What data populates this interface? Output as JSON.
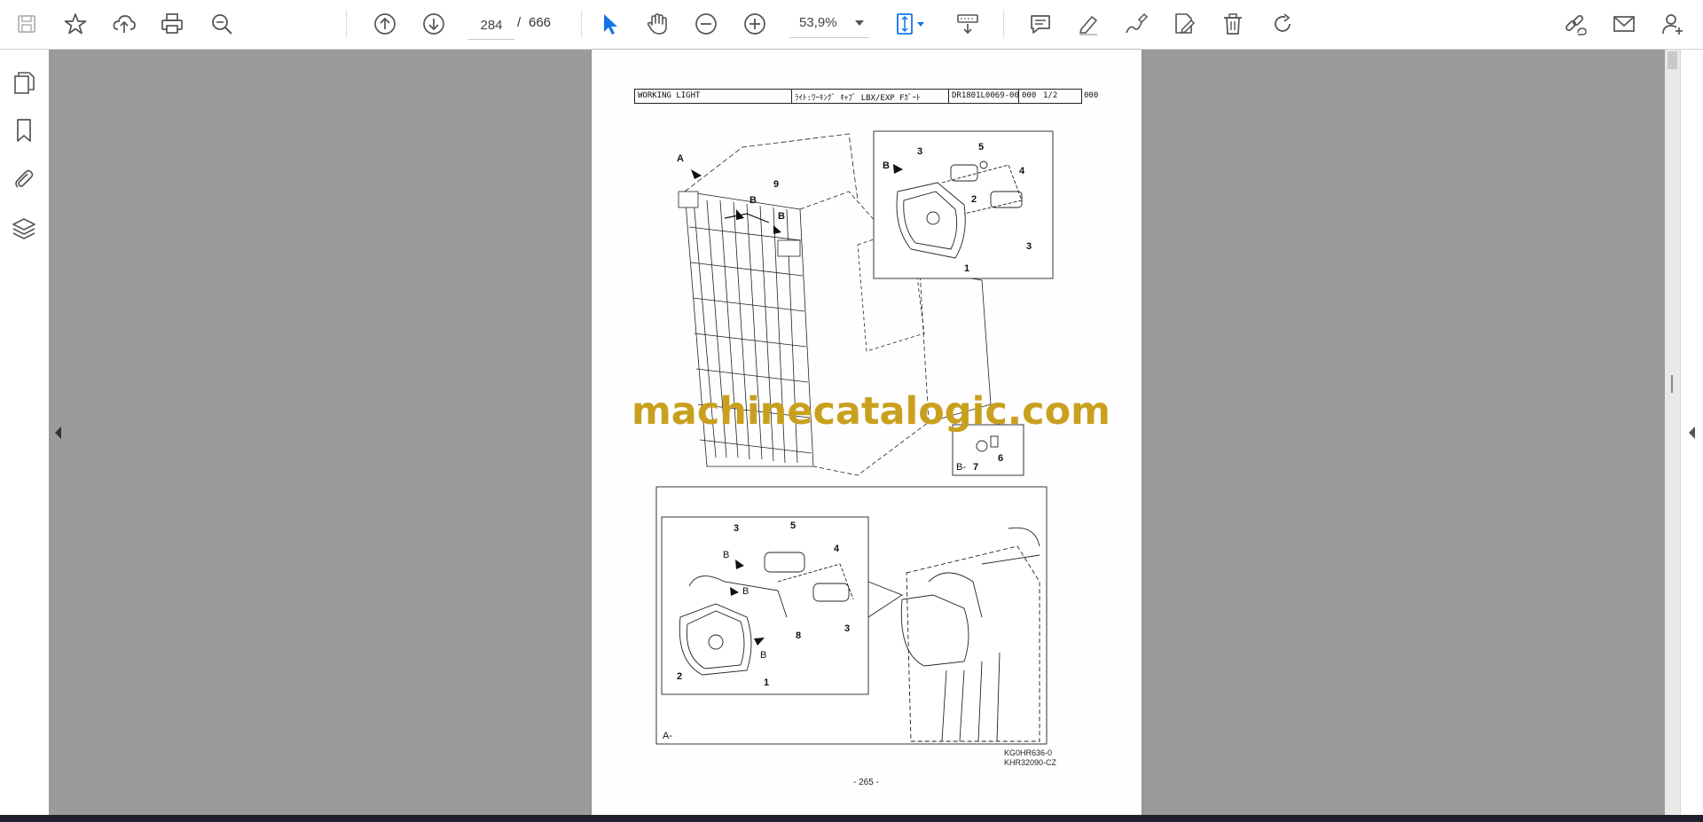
{
  "toolbar": {
    "page_current": "284",
    "page_separator": "/",
    "page_total": "666",
    "zoom": "53,9%",
    "icons": [
      "save-icon",
      "star-icon",
      "upload-icon",
      "print-icon",
      "zoom-search-icon",
      "page-up-icon",
      "page-down-icon",
      "select-cursor-icon",
      "hand-icon",
      "zoom-out-icon",
      "zoom-in-icon",
      "fit-page-icon",
      "scroll-mode-icon",
      "comment-icon",
      "highlight-icon",
      "draw-icon",
      "fill-sign-icon",
      "delete-icon",
      "rotate-icon",
      "share-link-icon",
      "email-icon",
      "add-user-icon"
    ]
  },
  "left_rail": {
    "icons": [
      "pages-icon",
      "bookmark-icon",
      "attachment-icon",
      "layers-icon"
    ]
  },
  "document": {
    "header": {
      "title": "WORKING LIGHT",
      "jp_title": "ﾗｲﾄ:ﾜｰｷﾝｸﾞ ｷｬﾌﾞ LBX/EXP Fｶﾞｰﾄ",
      "code": "DR1801L0069-00",
      "rev": "000",
      "sheet": "1/2",
      "extra": "000"
    },
    "watermark": "machinecatalogic.com",
    "callouts_main": [
      "A",
      "B",
      "B",
      "9"
    ],
    "callouts_detail_top": [
      "B",
      "3",
      "5",
      "4",
      "2",
      "3",
      "1"
    ],
    "callouts_detail_b": [
      "B-",
      "7",
      "6"
    ],
    "callouts_detail_a": [
      "3",
      "5",
      "4",
      "B",
      "B",
      "8",
      "3",
      "B",
      "2",
      "1",
      "A-"
    ],
    "figure_codes": [
      "KG0HR636-0",
      "KHR32090-CZ"
    ],
    "page_label": "- 265 -"
  },
  "colors": {
    "watermark": "#c9a01e",
    "accent_blue": "#1473e6",
    "viewer_bg": "#9b9b9b"
  }
}
